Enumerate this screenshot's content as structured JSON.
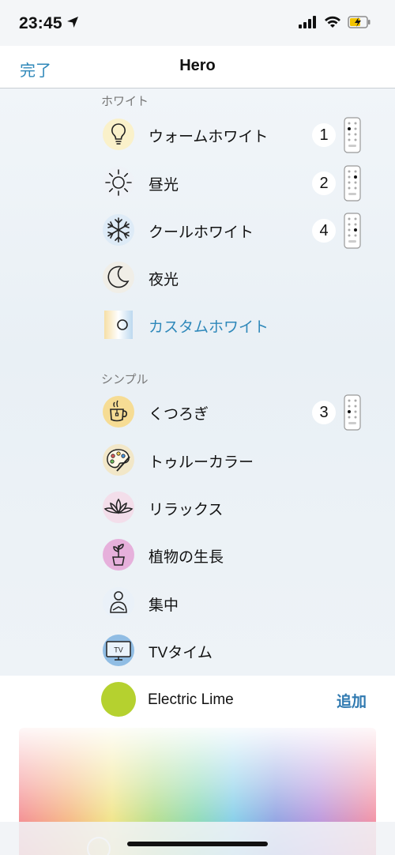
{
  "status_bar": {
    "time": "23:45",
    "icons": [
      "location-arrow-icon",
      "signal-icon",
      "wifi-icon",
      "battery-charging-icon"
    ]
  },
  "nav": {
    "done_label": "完了",
    "title": "Hero"
  },
  "sections": {
    "white": {
      "title": "ホワイト",
      "items": [
        {
          "label": "ウォームホワイト",
          "badge": "1",
          "icon": "lightbulb-icon"
        },
        {
          "label": "昼光",
          "badge": "2",
          "icon": "sun-icon"
        },
        {
          "label": "クールホワイト",
          "badge": "4",
          "icon": "snowflake-icon"
        },
        {
          "label": "夜光",
          "icon": "moon-icon"
        },
        {
          "label": "カスタムホワイト",
          "icon": "custom-white-icon"
        }
      ]
    },
    "simple": {
      "title": "シンプル",
      "items": [
        {
          "label": "くつろぎ",
          "badge": "3",
          "icon": "tea-cup-icon"
        },
        {
          "label": "トゥルーカラー",
          "icon": "palette-icon"
        },
        {
          "label": "リラックス",
          "icon": "lotus-icon"
        },
        {
          "label": "植物の生長",
          "icon": "plant-icon"
        },
        {
          "label": "集中",
          "icon": "person-icon"
        },
        {
          "label": "TVタイム",
          "icon": "tv-icon"
        }
      ]
    }
  },
  "tv_icon_text": "TV",
  "selected_color": {
    "name": "Electric Lime",
    "swatch": "#b5d12f"
  },
  "add_label": "追加",
  "colors": {
    "accent": "#2f88ba",
    "add": "#2f79b0"
  }
}
